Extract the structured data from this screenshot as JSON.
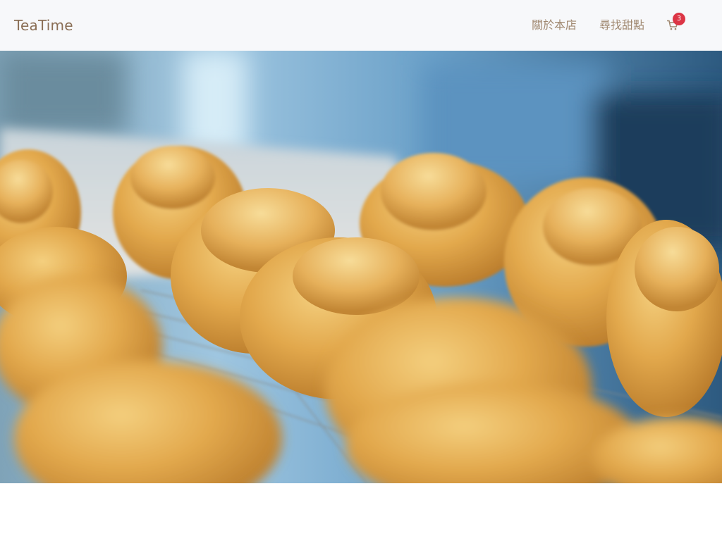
{
  "navbar": {
    "brand": "TeaTime",
    "links": [
      {
        "label": "關於本店"
      },
      {
        "label": "尋找甜點"
      }
    ],
    "cart": {
      "icon": "shopping-cart-icon",
      "count": "3"
    }
  },
  "hero": {
    "image": "cream-puffs-on-cooling-rack"
  },
  "colors": {
    "navbar_bg": "#f7f8fa",
    "brand": "#8a6e55",
    "link": "#a08870",
    "badge": "#dc3545"
  }
}
